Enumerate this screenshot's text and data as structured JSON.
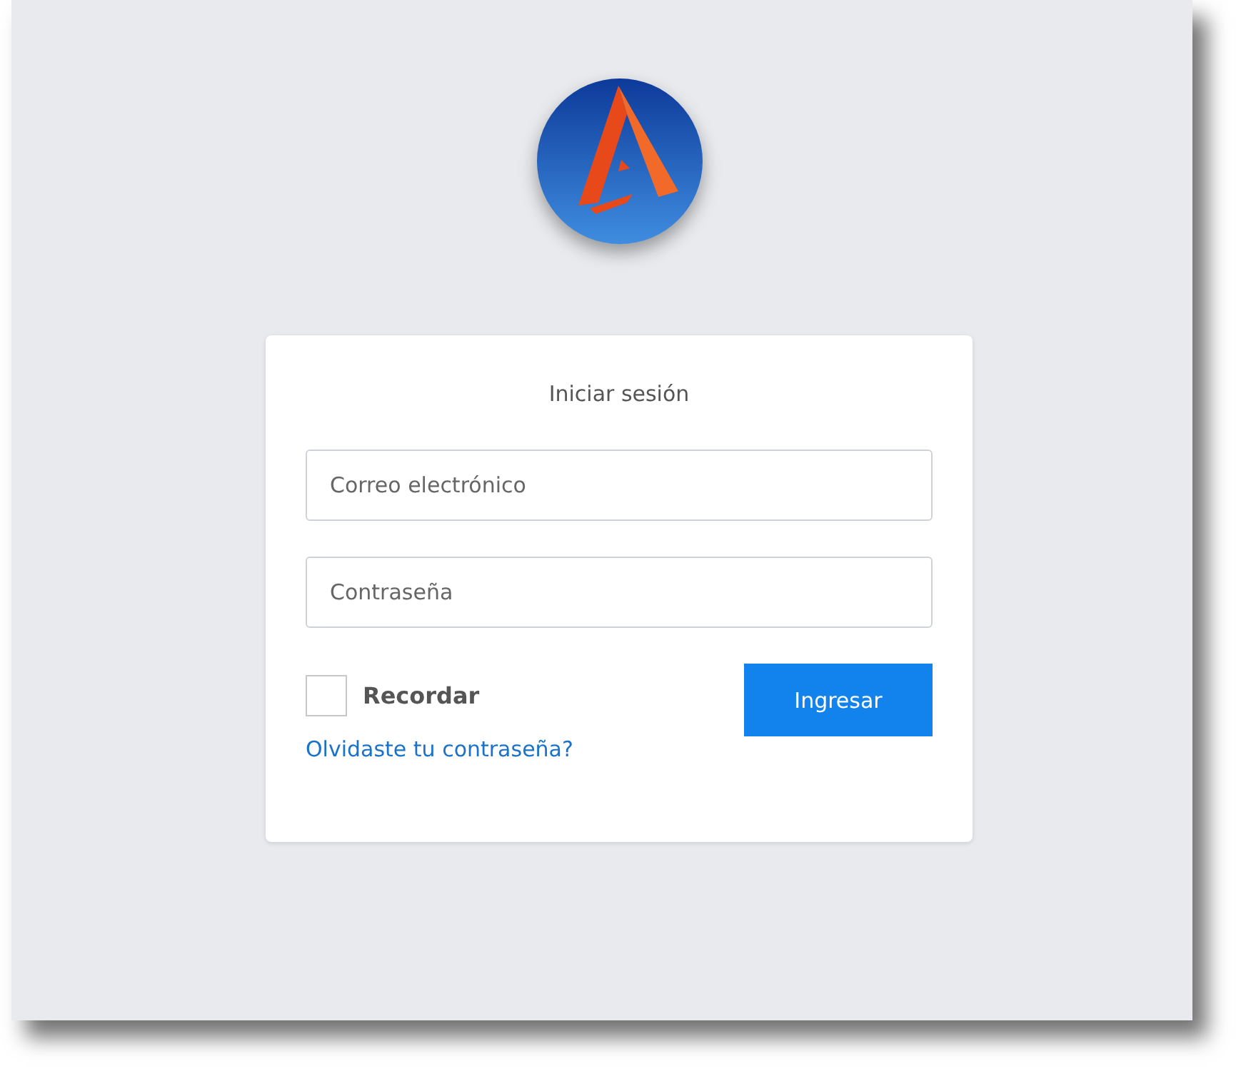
{
  "login": {
    "title": "Iniciar sesión",
    "email": {
      "placeholder": "Correo electrónico"
    },
    "password": {
      "placeholder": "Contraseña"
    },
    "remember": {
      "label": "Recordar",
      "checked": false
    },
    "submit": "Ingresar",
    "forgot_link": "Olvidaste tu contraseña?"
  }
}
